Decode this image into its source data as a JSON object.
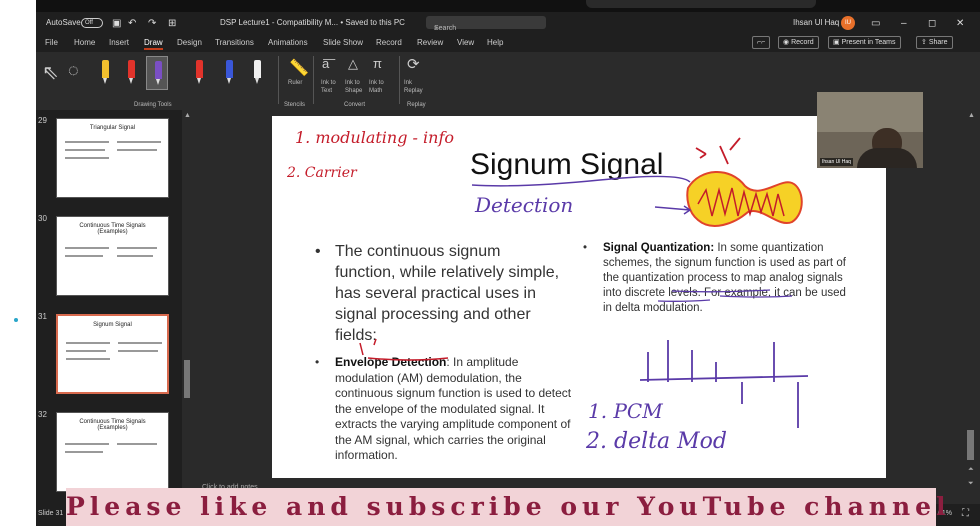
{
  "titlebar": {
    "autosave": "AutoSave",
    "toggle": "Off",
    "doc_title": "DSP Lecture1 - Compatibility M... • Saved to this PC",
    "search_placeholder": "Search",
    "user": "Ihsan Ul Haq",
    "avatar": "IU"
  },
  "menu": {
    "tabs": [
      "File",
      "Home",
      "Insert",
      "Draw",
      "Design",
      "Transitions",
      "Animations",
      "Slide Show",
      "Record",
      "Review",
      "View",
      "Help"
    ],
    "active": "Draw",
    "record_btn": "Record",
    "present_btn": "Present in Teams",
    "share_btn": "Share"
  },
  "ribbon": {
    "group_drawing_tools": "Drawing Tools",
    "ruler": "Ruler",
    "group_stencils": "Stencils",
    "ink_to_text": "Ink to Text",
    "ink_to_shape": "Ink to Shape",
    "ink_to_math": "Ink to Math",
    "group_convert": "Convert",
    "ink_replay": "Ink Replay",
    "group_replay": "Replay",
    "pen_colors": [
      "#f3c02e",
      "#e1332b",
      "#7a4fc4",
      "#e1332b",
      "#3a57d8",
      "#f0f0f0"
    ]
  },
  "thumbnails": [
    {
      "num": "29",
      "title": "Triangular Signal"
    },
    {
      "num": "30",
      "title": "Continuous Time Signals (Examples)"
    },
    {
      "num": "31",
      "title": "Signum Signal"
    },
    {
      "num": "32",
      "title": "Continuous Time Signals (Examples)"
    }
  ],
  "slide": {
    "title": "Signum Signal",
    "bullet1": "The continuous signum function, while relatively simple, has several practical uses in signal processing and other fields:",
    "bullet2_head": "Envelope Detection",
    "bullet2_body": ": In amplitude modulation (AM) demodulation, the continuous signum function is used to detect the envelope of the modulated signal. It extracts the varying amplitude component of the AM signal, which carries the original information.",
    "bullet3_head": "Signal Quantization:",
    "bullet3_body": " In some quantization schemes, the signum function is used as part of the quantization process to map analog signals into discrete levels. For example, it can be used in delta modulation."
  },
  "handwriting": {
    "line1": "1. modulating - info",
    "line2": "2. Carrier",
    "detection": "Detection",
    "pcm": "1. PCM",
    "delta": "2. delta Mod"
  },
  "webcam": {
    "name": "Ihsan Ul Haq"
  },
  "notes": {
    "placeholder": "Click to add notes"
  },
  "status": {
    "slide": "Slide 31",
    "zoom": "61%"
  },
  "banner": {
    "text": "Please like and subscribe our YouTube channel"
  }
}
